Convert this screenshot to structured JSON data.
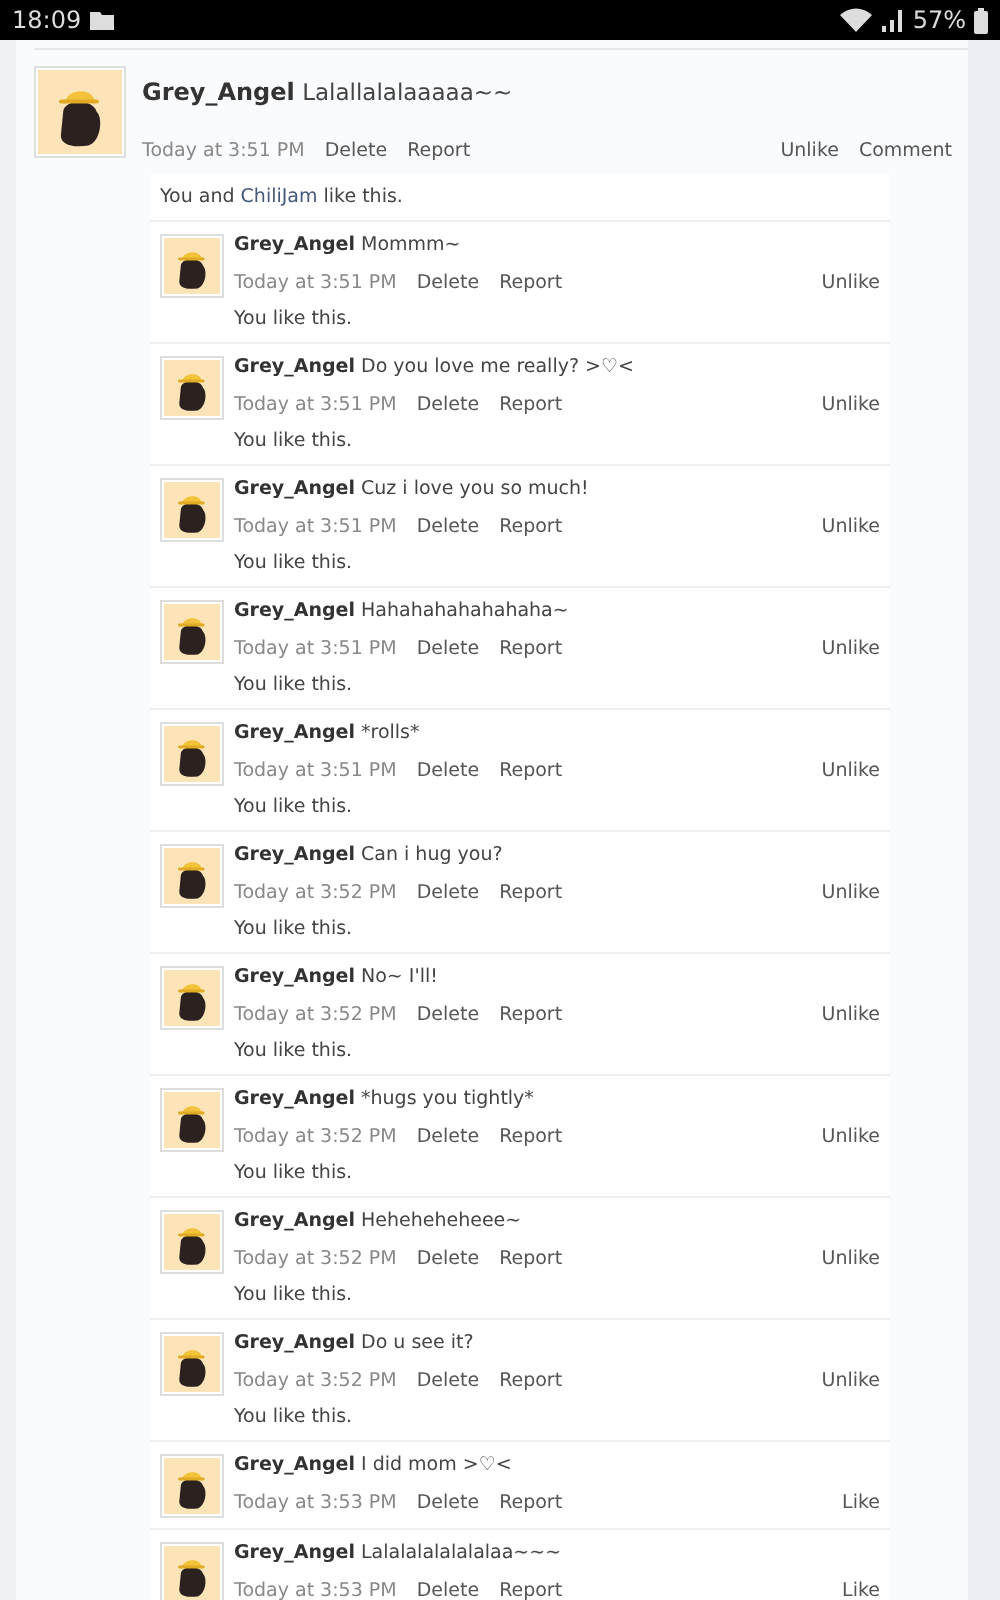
{
  "status_bar": {
    "time": "18:09",
    "battery": "57%"
  },
  "post": {
    "author": "Grey_Angel",
    "text": "Lalallalalaaaaa~~",
    "time": "Today at 3:51 PM",
    "actions": [
      "Delete",
      "Report"
    ],
    "right_actions": [
      "Unlike",
      "Comment"
    ],
    "likes": {
      "you": "You and ",
      "user": "ChiliJam",
      "rest": " like this."
    }
  },
  "comments": [
    {
      "author": "Grey_Angel",
      "text": "Mommm~",
      "time": "Today at 3:51 PM",
      "actions": [
        "Delete",
        "Report"
      ],
      "like_action": "Unlike",
      "likes": "You like this."
    },
    {
      "author": "Grey_Angel",
      "text": "Do you love me really? >♡<",
      "time": "Today at 3:51 PM",
      "actions": [
        "Delete",
        "Report"
      ],
      "like_action": "Unlike",
      "likes": "You like this."
    },
    {
      "author": "Grey_Angel",
      "text": "Cuz i love you so much!",
      "time": "Today at 3:51 PM",
      "actions": [
        "Delete",
        "Report"
      ],
      "like_action": "Unlike",
      "likes": "You like this."
    },
    {
      "author": "Grey_Angel",
      "text": "Hahahahahahahaha~",
      "time": "Today at 3:51 PM",
      "actions": [
        "Delete",
        "Report"
      ],
      "like_action": "Unlike",
      "likes": "You like this."
    },
    {
      "author": "Grey_Angel",
      "text": "*rolls*",
      "time": "Today at 3:51 PM",
      "actions": [
        "Delete",
        "Report"
      ],
      "like_action": "Unlike",
      "likes": "You like this."
    },
    {
      "author": "Grey_Angel",
      "text": "Can i hug you?",
      "time": "Today at 3:52 PM",
      "actions": [
        "Delete",
        "Report"
      ],
      "like_action": "Unlike",
      "likes": "You like this."
    },
    {
      "author": "Grey_Angel",
      "text": "No~ I'll!",
      "time": "Today at 3:52 PM",
      "actions": [
        "Delete",
        "Report"
      ],
      "like_action": "Unlike",
      "likes": "You like this."
    },
    {
      "author": "Grey_Angel",
      "text": "*hugs you tightly*",
      "time": "Today at 3:52 PM",
      "actions": [
        "Delete",
        "Report"
      ],
      "like_action": "Unlike",
      "likes": "You like this."
    },
    {
      "author": "Grey_Angel",
      "text": "Heheheheheee~",
      "time": "Today at 3:52 PM",
      "actions": [
        "Delete",
        "Report"
      ],
      "like_action": "Unlike",
      "likes": "You like this."
    },
    {
      "author": "Grey_Angel",
      "text": "Do u see it?",
      "time": "Today at 3:52 PM",
      "actions": [
        "Delete",
        "Report"
      ],
      "like_action": "Unlike",
      "likes": "You like this."
    },
    {
      "author": "Grey_Angel",
      "text": "I did mom >♡<",
      "time": "Today at 3:53 PM",
      "actions": [
        "Delete",
        "Report"
      ],
      "like_action": "Like"
    },
    {
      "author": "Grey_Angel",
      "text": "Lalalalalalalalaa~~~",
      "time": "Today at 3:53 PM",
      "actions": [
        "Delete",
        "Report"
      ],
      "like_action": "Like"
    }
  ]
}
